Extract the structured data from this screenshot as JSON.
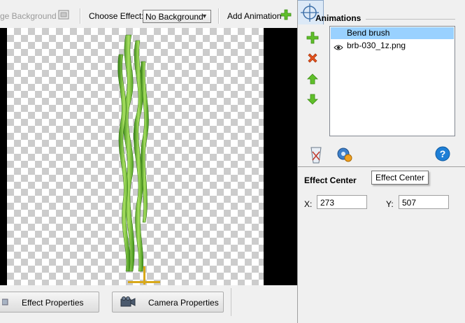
{
  "toolbar": {
    "background_label": "ge Background",
    "choose_effect_label": "Choose Effect:",
    "effect_value": "No Background",
    "add_animation_label": "Add Animation"
  },
  "bottom": {
    "effect_properties": "Effect Properties",
    "camera_properties": "Camera Properties"
  },
  "animations": {
    "title": "Animations",
    "items": [
      {
        "label": "Bend brush",
        "selected": true
      },
      {
        "label": "brb-030_1z.png",
        "selected": false
      }
    ]
  },
  "tabs": [
    "settings-tab",
    "gear-tab",
    "effect-center-tab",
    "help-tab"
  ],
  "effect_center": {
    "title": "Effect Center",
    "tooltip": "Effect Center",
    "x_label": "X:",
    "x_value": "273",
    "y_label": "Y:",
    "y_value": "507"
  },
  "colors": {
    "selection": "#99d1ff",
    "green_icon": "#5fbf2a",
    "delete_icon": "#e8531d",
    "help_icon": "#1e7fd6"
  }
}
